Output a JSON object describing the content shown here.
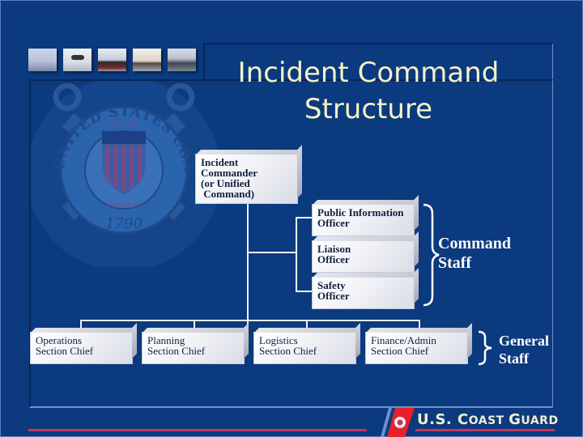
{
  "slide": {
    "title_line1": "Incident Command",
    "title_line2": "Structure",
    "colors": {
      "background": "#0b3a7e",
      "title": "#f6f2c8",
      "accent_red": "#e8202c",
      "stripe": "#c8335a"
    }
  },
  "header_photos": [
    {
      "name": "patrol-boat-photo"
    },
    {
      "name": "helicopter-rescue-photo"
    },
    {
      "name": "cargo-ship-photo"
    },
    {
      "name": "cutter-photo"
    },
    {
      "name": "icebreaker-photo"
    }
  ],
  "seal": {
    "text": "UNITED STATES COAST GUARD",
    "motto_top": "SEMPER",
    "motto_bottom": "PARATUS",
    "year": "1790"
  },
  "org_chart": {
    "commander": {
      "lines": [
        "Incident",
        "Commander",
        "(or Unified",
        " Command)"
      ]
    },
    "command_staff": [
      {
        "lines": [
          "Public Information",
          "Officer"
        ]
      },
      {
        "lines": [
          "Liaison",
          "Officer"
        ]
      },
      {
        "lines": [
          "Safety",
          "Officer"
        ]
      }
    ],
    "command_staff_label": [
      "Command",
      "Staff"
    ],
    "general_staff": [
      {
        "lines": [
          "Operations",
          "Section Chief"
        ]
      },
      {
        "lines": [
          "Planning",
          "Section Chief"
        ]
      },
      {
        "lines": [
          "Logistics",
          "Section Chief"
        ]
      },
      {
        "lines": [
          "Finance/Admin",
          "Section Chief"
        ]
      }
    ],
    "general_staff_label": [
      "General",
      "Staff"
    ]
  },
  "footer": {
    "logo_text_main": "U.S. C",
    "logo_text_oast": "OAST ",
    "logo_text_g": "G",
    "logo_text_uard": "UARD"
  }
}
